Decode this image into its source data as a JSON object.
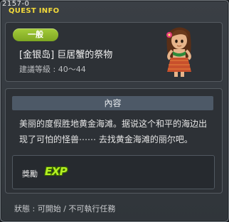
{
  "window": {
    "quest_id": "2157-0",
    "title": "QUEST INFO"
  },
  "quest": {
    "badge": "一般",
    "title": "[金银岛] 巨居蟹的祭物",
    "level": "建議等級 : 40～44",
    "npc_icon": "hula-girl-npc"
  },
  "content": {
    "heading": "內容",
    "description": "美丽的度假胜地黄金海滩。据说这个和平的海边出现了可怕的怪兽⋯⋯ 去找黄金海滩的丽尔吧。"
  },
  "reward": {
    "label": "獎勵",
    "icon_text": "EXP"
  },
  "status": "狀態 : 可開始  / 不可執行任務",
  "colors": {
    "title": "#f2d93a",
    "badge": "#8fbb2c",
    "exp": "#b5f022",
    "section_bar": "#4d5967"
  }
}
